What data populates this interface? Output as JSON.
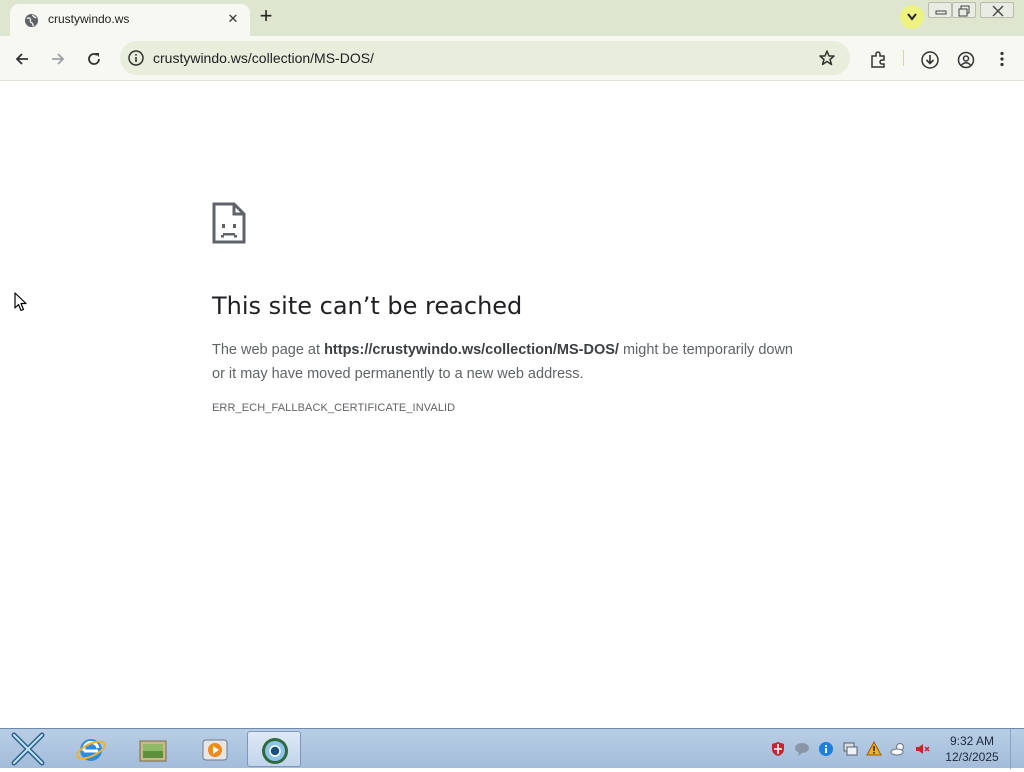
{
  "browser": {
    "tab": {
      "title": "crustywindo.ws",
      "favicon": "globe-icon",
      "close_glyph": "✕"
    },
    "new_tab_glyph": "+",
    "address": "crustywindo.ws/collection/MS-DOS/"
  },
  "error_page": {
    "title": "This site can’t be reached",
    "body_prefix": "The web page at ",
    "body_url": "https://crustywindo.ws/collection/MS-DOS/",
    "body_suffix": " might be temporarily down or it may have moved permanently to a new web address.",
    "error_code": "ERR_ECH_FALLBACK_CERTIFICATE_INVALID"
  },
  "taskbar": {
    "apps": [
      "start-icon",
      "internet-explorer-icon",
      "file-explorer-icon",
      "media-player-icon",
      "browser-icon"
    ],
    "tray": [
      "security-shield-icon",
      "chat-icon",
      "info-icon",
      "network-icon",
      "warning-icon",
      "weather-icon",
      "mute-icon"
    ],
    "clock_time": "9:32 AM",
    "clock_date": "12/3/2025"
  },
  "colors": {
    "tabstrip": "#dfe6cf",
    "toolbar": "#f7f8f2",
    "omnibox": "#e8eddc",
    "accent": "#eef281",
    "taskbar": "#a3bcd9"
  }
}
